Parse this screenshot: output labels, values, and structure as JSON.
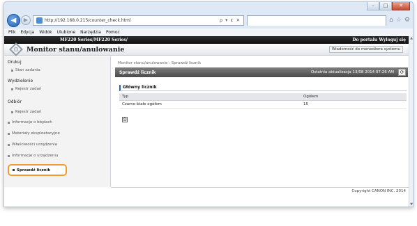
{
  "browser": {
    "url": "http://192.168.0.215/counter_check.html",
    "url_controls": "ρ ▾ ¢ ✕",
    "menu": [
      "Plik",
      "Edycja",
      "Widok",
      "Ulubione",
      "Narzędzia",
      "Pomoc"
    ],
    "window_controls": {
      "minimize": "–",
      "maximize": "□",
      "close": "✕"
    },
    "tool_icons": [
      "home-icon",
      "star-icon",
      "gear-icon"
    ]
  },
  "model_bar": {
    "model": "MF220 Series/MF220 Series/",
    "portal_link": "Do portalu  Wyloguj się"
  },
  "header": {
    "title": "Monitor stanu/anulowanie",
    "admin_link": "Wiadomość do menedżera systemu"
  },
  "sidebar": {
    "groups": [
      {
        "heading": "Drukuj",
        "items": [
          "Stan zadania"
        ]
      },
      {
        "heading": "Wydzielenie",
        "items": [
          "Rejestr zadań"
        ]
      },
      {
        "heading": "Odbiór",
        "items": [
          "Rejestr zadań"
        ]
      }
    ],
    "links": [
      "Informacje o błędach",
      "Materiały eksploatacyjne",
      "Właściwości urządzenia",
      "Informacje o urządzeniu"
    ],
    "active": "Sprawdź licznik"
  },
  "main": {
    "breadcrumb": "Monitor stanu/anulowanie : Sprawdź licznik",
    "section_title": "Sprawdź licznik",
    "last_update": "Ostatnia aktualizacja 13/08 2014 07:26 AM",
    "sub_title": "Główny licznik",
    "table": {
      "headers": [
        "Typ",
        "Ogółem"
      ],
      "rows": [
        [
          "Czarno-białe ogółem",
          "15"
        ]
      ]
    }
  },
  "footer": {
    "copyright": "Copyright CANON INC. 2014"
  }
}
